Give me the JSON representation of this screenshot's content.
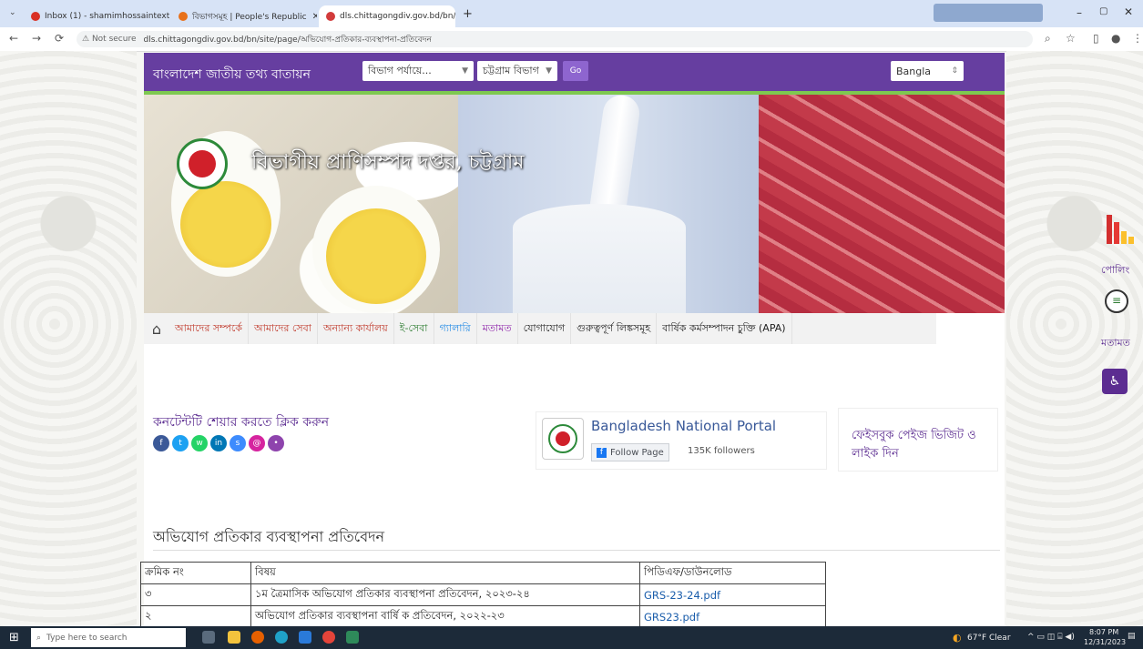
{
  "browser": {
    "tabs": [
      {
        "label": "Inbox (1) - shamimhossaintext",
        "fav": "#d93025"
      },
      {
        "label": "বিভাগসমূহ | People's Republic",
        "fav": "#e8711a"
      },
      {
        "label": "dls.chittagongdiv.gov.bd/bn/site",
        "fav": "#d23b3b"
      }
    ],
    "new_tab": "+",
    "not_secure": "Not secure",
    "url": "dls.chittagongdiv.gov.bd/bn/site/page/অভিযোগ-প্রতিকার-ব্যবস্থাপনা-প্রতিবেদন"
  },
  "topbar": {
    "portal_title": "বাংলাদেশ জাতীয় তথ্য বাতায়ন",
    "select_level": "বিভাগ পর্যায়ে...",
    "select_division": "চট্টগ্রাম বিভাগ",
    "go_label": "Go",
    "language": "Bangla"
  },
  "banner": {
    "site_title": "বিভাগীয় প্রাণিসম্পদ দপ্তর, চট্টগ্রাম"
  },
  "menu": {
    "items": [
      {
        "label": "আমাদের সম্পর্কে",
        "color": "#c0392b"
      },
      {
        "label": "আমাদের সেবা",
        "color": "#c0392b"
      },
      {
        "label": "অন্যান্য কার্যালয়",
        "color": "#c0392b"
      },
      {
        "label": "ই-সেবা",
        "color": "#2e7d32"
      },
      {
        "label": "গ্যালারি",
        "color": "#1e88e5"
      },
      {
        "label": "মতামত",
        "color": "#8e24aa"
      },
      {
        "label": "যোগাযোগ",
        "color": "#333333"
      },
      {
        "label": "গুরুত্বপূর্ণ লিঙ্কসমূহ",
        "color": "#333333"
      },
      {
        "label": "বার্ষিক কর্মসম্পাদন চুক্তি (APA)",
        "color": "#333333"
      }
    ]
  },
  "share": {
    "title": "কনটেন্টটি শেয়ার করতে ক্লিক করুন",
    "icons": [
      {
        "name": "facebook-icon",
        "color": "#3b5998",
        "glyph": "f"
      },
      {
        "name": "twitter-icon",
        "color": "#1da1f2",
        "glyph": "t"
      },
      {
        "name": "whatsapp-icon",
        "color": "#25d366",
        "glyph": "w"
      },
      {
        "name": "linkedin-icon",
        "color": "#0077b5",
        "glyph": "in"
      },
      {
        "name": "link-icon",
        "color": "#3d8bfd",
        "glyph": "s"
      },
      {
        "name": "email-icon",
        "color": "#d6249f",
        "glyph": "@"
      },
      {
        "name": "more-icon",
        "color": "#8e44ad",
        "glyph": "•"
      }
    ]
  },
  "national_portal": {
    "name": "Bangladesh National Portal",
    "follow": "Follow Page",
    "followers": "135K followers"
  },
  "facebook_visit": "ফেইসবুক পেইজ ভিজিট ও লাইক দিন",
  "report": {
    "title": "অভিযোগ প্রতিকার ব্যবস্থাপনা প্রতিবেদন",
    "headers": [
      "ক্রমিক নং",
      "বিষয়",
      "পিডিএফ/ডাউনলোড"
    ],
    "rows": [
      {
        "sl": "৩",
        "subject": "১ম ত্রৈমাসিক অভিযোগ প্রতিকার ব্যবস্থাপনা প্রতিবেদন, ২০২৩-২৪",
        "file": "GRS-23-24.pdf"
      },
      {
        "sl": "২",
        "subject": "অভিযোগ প্রতিকার ব্যবস্থাপনা বার্ষি ক প্রতিবেদন, ২০২২-২৩",
        "file": "GRS23.pdf"
      }
    ]
  },
  "sidebar_right": {
    "poll": "পোলিং",
    "feedback": "মতামত"
  },
  "taskbar": {
    "search": "Type here to search",
    "weather": "67°F Clear",
    "time": "8:07 PM",
    "date": "12/31/2023"
  }
}
